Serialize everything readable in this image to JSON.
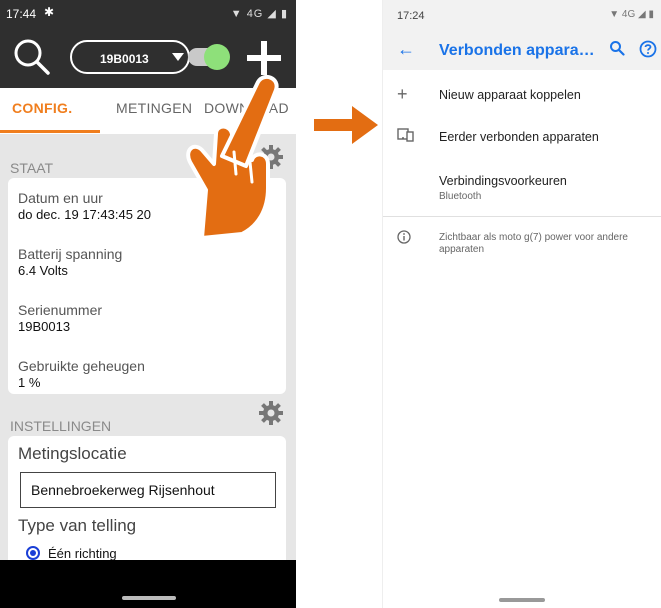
{
  "left_phone": {
    "status_time": "17:44",
    "status_icons": "▼ 4G ◢ ▮",
    "toolbar": {
      "device_name": "19B0013"
    },
    "tabs": [
      {
        "label": "CONFIG."
      },
      {
        "label": "METINGEN"
      },
      {
        "label": "DOWNLOAD"
      }
    ],
    "staat": {
      "title": "STAAT",
      "fields": [
        {
          "label": "Datum en uur",
          "value": "do dec. 19 17:43:45 20"
        },
        {
          "label": "Batterij spanning",
          "value": "6.4 Volts"
        },
        {
          "label": "Serienummer",
          "value": "19B0013"
        },
        {
          "label": "Gebruikte geheugen",
          "value": "1 %"
        }
      ]
    },
    "instellingen": {
      "title": "INSTELLINGEN",
      "location_label": "Metingslocatie",
      "location_value": "Bennebroekerweg Rijsenhout",
      "count_type_label": "Type van telling",
      "radio_option": "Één richting"
    }
  },
  "right_phone": {
    "status_time": "17:24",
    "status_icons": "▼ 4G ◢ ▮",
    "title": "Verbonden appara…",
    "items": [
      {
        "icon": "plus-icon",
        "label": "Nieuw apparaat koppelen"
      },
      {
        "icon": "devices-icon",
        "label": "Eerder verbonden apparaten"
      },
      {
        "icon": "",
        "label": "Verbindingsvoorkeuren",
        "sub": "Bluetooth"
      }
    ],
    "info_text": "Zichtbaar als moto g(7) power voor andere apparaten"
  },
  "colors": {
    "accent_orange": "#f07e1e",
    "toolbar_dark": "#2f2f2f",
    "link_blue": "#1a73e8",
    "toggle_green": "#8ee07a"
  }
}
